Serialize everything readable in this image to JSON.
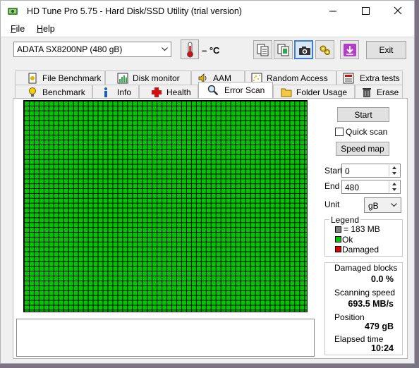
{
  "window": {
    "title": "HD Tune Pro 5.75 - Hard Disk/SSD Utility (trial version)",
    "menu": [
      {
        "label_u": "F",
        "label_rest": "ile"
      },
      {
        "label_u": "H",
        "label_rest": "elp"
      }
    ]
  },
  "toolbar": {
    "drive": "ADATA SX8200NP (480 gB)",
    "temperature": "– °C",
    "exit_label": "Exit",
    "icons": [
      "copy-text-icon",
      "copy-screenshot-icon",
      "camera-icon",
      "settings-icon",
      "download-icon"
    ]
  },
  "tabs": {
    "row1": [
      "File Benchmark",
      "Disk monitor",
      "AAM",
      "Random Access",
      "Extra tests"
    ],
    "row2": [
      "Benchmark",
      "Info",
      "Health",
      "Error Scan",
      "Folder Usage",
      "Erase"
    ],
    "active": "Error Scan"
  },
  "controls": {
    "start_button": "Start",
    "quick_scan_label": "Quick scan",
    "quick_scan_checked": false,
    "speed_map_button": "Speed map",
    "start_label": "Start",
    "start_value": "0",
    "end_label": "End",
    "end_value": "480",
    "unit_label": "Unit",
    "unit_value": "gB"
  },
  "legend": {
    "title": "Legend",
    "items": [
      {
        "text": "= 183 MB",
        "color": "#808080"
      },
      {
        "text": "Ok",
        "color": "#00c800"
      },
      {
        "text": "Damaged",
        "color": "#e00000"
      }
    ]
  },
  "stats": {
    "damaged_blocks_label": "Damaged blocks",
    "damaged_blocks_value": "0.0 %",
    "scanning_speed_label": "Scanning speed",
    "scanning_speed_value": "693.5 MB/s",
    "position_label": "Position",
    "position_value": "479 gB",
    "elapsed_label": "Elapsed time",
    "elapsed_value": "10:24"
  },
  "scan_grid": {
    "ok_color": "#00c800",
    "status": "all blocks ok"
  }
}
